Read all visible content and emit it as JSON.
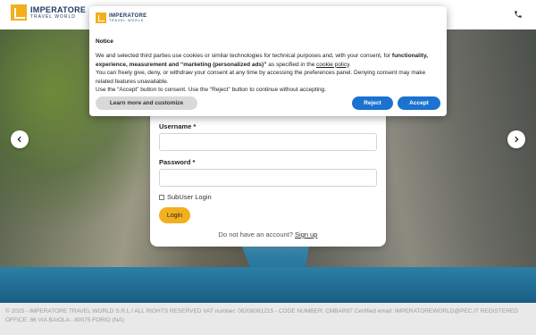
{
  "header": {
    "logo_name": "IMPERATORE",
    "logo_sub": "TRAVEL WORLD",
    "phone_icon": "phone-icon"
  },
  "hero": {
    "prev_icon": "chevron-left-icon",
    "next_icon": "chevron-right-icon"
  },
  "login": {
    "username_label": "Username *",
    "username_value": "",
    "password_label": "Password *",
    "password_value": "",
    "subuser_label": "SubUser Login",
    "login_button": "Login",
    "signup_prompt": "Do not have an account?",
    "signup_link": "Sign up"
  },
  "cookie_notice": {
    "logo_name": "IMPERATORE",
    "logo_sub": "TRAVEL WORLD",
    "title": "Notice",
    "para1_a": "We and selected third parties use cookies or similar technologies for technical purposes and, with your consent, for ",
    "para1_bold": "functionality, experience, measurement and “marketing (personalized ads)”",
    "para1_b": " as specified in the ",
    "para1_link": "cookie policy",
    "para1_c": ".",
    "para2": "You can freely give, deny, or withdraw your consent at any time by accessing the preferences panel. Denying consent may make related features unavailable.",
    "para3": "Use the “Accept” button to consent. Use the “Reject” button to continue without accepting.",
    "learn_button": "Learn more and customize",
    "reject_button": "Reject",
    "accept_button": "Accept"
  },
  "footer": {
    "text": "© 2025 - IMPERATORE TRAVEL WORLD S.R.L / ALL RIGHTS RESERVED VAT number: 06208081215 - CODE NUMBER: CMBAR97 Certified email: IMPERATOREWORLD@PEC.IT REGISTERED OFFICE: 86 VIA BAIOLA - 80075 FORIO (NA)"
  },
  "colors": {
    "accent": "#f2b01e",
    "brand_blue": "#1f3a63",
    "button_blue": "#1b72cf"
  }
}
